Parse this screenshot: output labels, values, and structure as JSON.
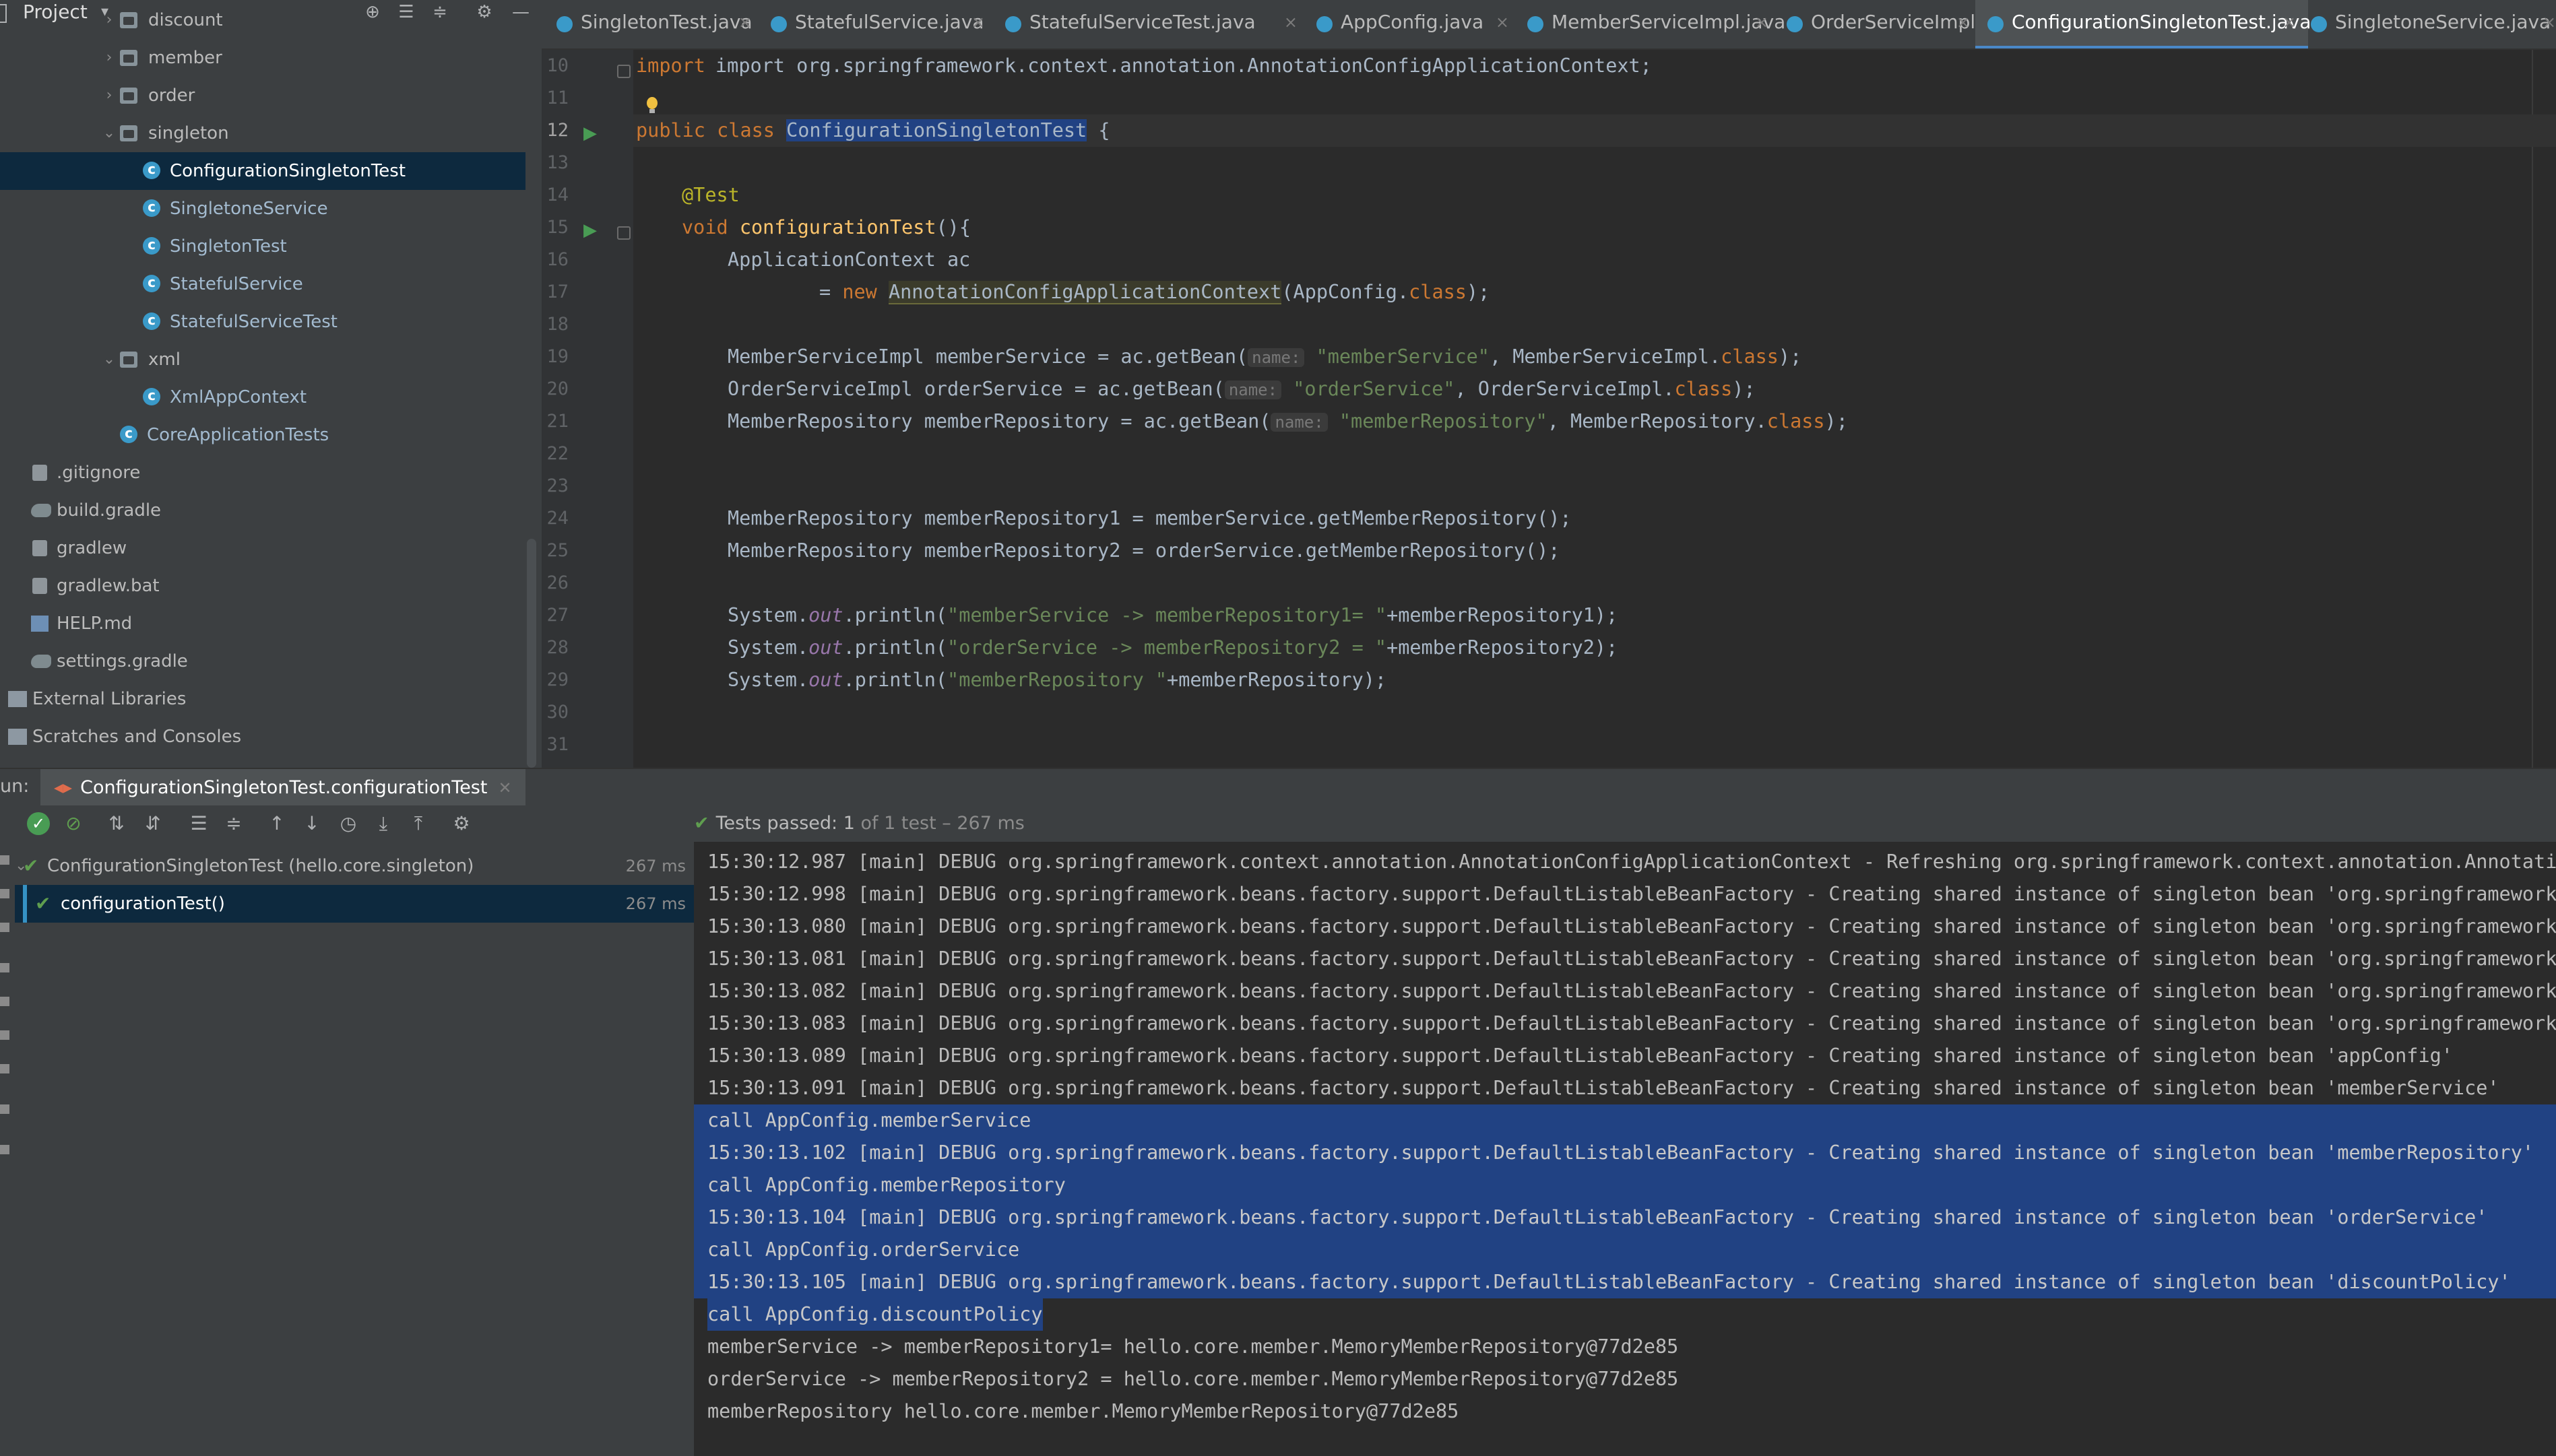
{
  "project": {
    "title": "Project",
    "tree": [
      {
        "label": "discount",
        "kind": "folder",
        "chevron": "›"
      },
      {
        "label": "member",
        "kind": "folder",
        "chevron": "›"
      },
      {
        "label": "order",
        "kind": "folder",
        "chevron": "›"
      },
      {
        "label": "singleton",
        "kind": "folder",
        "chevron": "⌄"
      },
      {
        "label": "ConfigurationSingletonTest",
        "kind": "java",
        "selected": true
      },
      {
        "label": "SingletoneService",
        "kind": "java"
      },
      {
        "label": "SingletonTest",
        "kind": "java"
      },
      {
        "label": "StatefulService",
        "kind": "java"
      },
      {
        "label": "StatefulServiceTest",
        "kind": "java"
      },
      {
        "label": "xml",
        "kind": "folder",
        "chevron": "⌄"
      },
      {
        "label": "XmlAppContext",
        "kind": "java"
      },
      {
        "label": "CoreApplicationTests",
        "kind": "java"
      },
      {
        "label": ".gitignore",
        "kind": "file"
      },
      {
        "label": "build.gradle",
        "kind": "gradle"
      },
      {
        "label": "gradlew",
        "kind": "file"
      },
      {
        "label": "gradlew.bat",
        "kind": "file"
      },
      {
        "label": "HELP.md",
        "kind": "md"
      },
      {
        "label": "settings.gradle",
        "kind": "gradle"
      },
      {
        "label": "External Libraries",
        "kind": "lib"
      },
      {
        "label": "Scratches and Consoles",
        "kind": "lib"
      }
    ]
  },
  "tabs": [
    {
      "label": "SingletonTest.java"
    },
    {
      "label": "StatefulService.java"
    },
    {
      "label": "StatefulServiceTest.java"
    },
    {
      "label": "AppConfig.java"
    },
    {
      "label": "MemberServiceImpl.java"
    },
    {
      "label": "OrderServiceImpl.java"
    },
    {
      "label": "ConfigurationSingletonTest.java",
      "active": true
    },
    {
      "label": "SingletoneService.java"
    }
  ],
  "editor": {
    "line_numbers": [
      "10",
      "11",
      "12",
      "13",
      "14",
      "15",
      "16",
      "17",
      "18",
      "19",
      "20",
      "21",
      "22",
      "23",
      "24",
      "25",
      "26",
      "27",
      "28",
      "29",
      "30",
      "31"
    ],
    "current_line": "12",
    "hint_label": "name:",
    "code": {
      "l10": {
        "a": "import org.springframework.context.annotation.AnnotationConfigApplicationContext;"
      },
      "l12": {
        "kw1": "public",
        "kw2": "class",
        "cls": "ConfigurationSingletonTest",
        "rest": " {"
      },
      "l14": {
        "ann": "@Test"
      },
      "l15": {
        "kw": "void",
        "fn": "configurationTest",
        "rest": "(){"
      },
      "l16": {
        "a": "ApplicationContext ac"
      },
      "l17": {
        "eq": "= ",
        "kw": "new",
        "cls": "AnnotationConfigApplicationContext",
        "arg": "(AppConfig.",
        "kw2": "class",
        "end": ");"
      },
      "l19": {
        "a": "MemberServiceImpl memberService = ac.getBean(",
        "str": "\"memberService\"",
        "b": ", MemberServiceImpl.",
        "kw": "class",
        "end": ");"
      },
      "l20": {
        "a": "OrderServiceImpl orderService = ac.getBean(",
        "str": "\"orderService\"",
        "b": ", OrderServiceImpl.",
        "kw": "class",
        "end": ");"
      },
      "l21": {
        "a": "MemberRepository memberRepository = ac.getBean(",
        "str": "\"memberRepository\"",
        "b": ", MemberRepository.",
        "kw": "class",
        "end": ");"
      },
      "l24": {
        "a": "MemberRepository memberRepository1 = memberService.getMemberRepository();"
      },
      "l25": {
        "a": "MemberRepository memberRepository2 = orderService.getMemberRepository();"
      },
      "l27": {
        "a": "System.",
        "fld": "out",
        "b": ".println(",
        "str": "\"memberService -> memberRepository1= \"",
        "c": "+memberRepository1);"
      },
      "l28": {
        "a": "System.",
        "fld": "out",
        "b": ".println(",
        "str": "\"orderService -> memberRepository2 = \"",
        "c": "+memberRepository2);"
      },
      "l29": {
        "a": "System.",
        "fld": "out",
        "b": ".println(",
        "str": "\"memberRepository \"",
        "c": "+memberRepository);"
      }
    }
  },
  "run": {
    "label": "un:",
    "tab": "ConfigurationSingletonTest.configurationTest",
    "status_prefix": "Tests passed:",
    "status_count": "1",
    "status_rest": "of 1 test – 267 ms",
    "tests": [
      {
        "label": "ConfigurationSingletonTest (hello.core.singleton)",
        "time": "267 ms"
      },
      {
        "label": "configurationTest()",
        "time": "267 ms",
        "selected": true
      }
    ],
    "console": [
      {
        "text": "15:30:12.987 [main] DEBUG org.springframework.context.annotation.AnnotationConfigApplicationContext - Refreshing org.springframework.context.annotation.AnnotationCo"
      },
      {
        "text": "15:30:12.998 [main] DEBUG org.springframework.beans.factory.support.DefaultListableBeanFactory - Creating shared instance of singleton bean 'org.springframework.co"
      },
      {
        "text": "15:30:13.080 [main] DEBUG org.springframework.beans.factory.support.DefaultListableBeanFactory - Creating shared instance of singleton bean 'org.springframework.co"
      },
      {
        "text": "15:30:13.081 [main] DEBUG org.springframework.beans.factory.support.DefaultListableBeanFactory - Creating shared instance of singleton bean 'org.springframework.co"
      },
      {
        "text": "15:30:13.082 [main] DEBUG org.springframework.beans.factory.support.DefaultListableBeanFactory - Creating shared instance of singleton bean 'org.springframework.co"
      },
      {
        "text": "15:30:13.083 [main] DEBUG org.springframework.beans.factory.support.DefaultListableBeanFactory - Creating shared instance of singleton bean 'org.springframework.co"
      },
      {
        "text": "15:30:13.089 [main] DEBUG org.springframework.beans.factory.support.DefaultListableBeanFactory - Creating shared instance of singleton bean 'appConfig'"
      },
      {
        "text": "15:30:13.091 [main] DEBUG org.springframework.beans.factory.support.DefaultListableBeanFactory - Creating shared instance of singleton bean 'memberService'"
      },
      {
        "text": "call AppConfig.memberService",
        "selected": true
      },
      {
        "text": "15:30:13.102 [main] DEBUG org.springframework.beans.factory.support.DefaultListableBeanFactory - Creating shared instance of singleton bean 'memberRepository'",
        "selected": true
      },
      {
        "text": "call AppConfig.memberRepository",
        "selected": true
      },
      {
        "text": "15:30:13.104 [main] DEBUG org.springframework.beans.factory.support.DefaultListableBeanFactory - Creating shared instance of singleton bean 'orderService'",
        "selected": true
      },
      {
        "text": "call AppConfig.orderService",
        "selected": true
      },
      {
        "text": "15:30:13.105 [main] DEBUG org.springframework.beans.factory.support.DefaultListableBeanFactory - Creating shared instance of singleton bean 'discountPolicy'",
        "selected": true
      },
      {
        "text": "call AppConfig.discountPolicy",
        "selected": "partial"
      },
      {
        "text": "memberService -> memberRepository1= hello.core.member.MemoryMemberRepository@77d2e85"
      },
      {
        "text": "orderService -> memberRepository2 = hello.core.member.MemoryMemberRepository@77d2e85"
      },
      {
        "text": "memberRepository hello.core.member.MemoryMemberRepository@77d2e85"
      }
    ]
  },
  "colors": {
    "selection": "#214283",
    "test_pass": "#5f9e4f",
    "keyword": "#cc7832",
    "string": "#6a8759"
  }
}
